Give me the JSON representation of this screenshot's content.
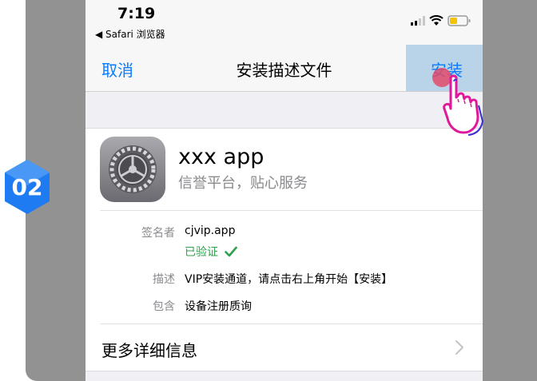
{
  "step": {
    "number": "02",
    "color": "#1e7bf2"
  },
  "status_bar": {
    "time": "7:19",
    "back_app": "◀ Safari 浏览器",
    "icons": [
      "signal-icon",
      "wifi-icon",
      "battery-icon"
    ]
  },
  "nav": {
    "cancel_label": "取消",
    "title": "安装描述文件",
    "install_label": "安装"
  },
  "profile": {
    "name": "xxx app",
    "subtitle": "信誉平台，贴心服务",
    "icon": "settings-gear-icon"
  },
  "details": {
    "signer_label": "签名者",
    "signer_value": "cjvip.app",
    "verified_label": "已验证",
    "description_label": "描述",
    "description_value": "VIP安装通道，请点击右上角开始【安装】",
    "contains_label": "包含",
    "contains_value": "设备注册质询"
  },
  "more": {
    "label": "更多详细信息"
  },
  "colors": {
    "accent": "#0a7aff",
    "verified": "#2ca14a",
    "backdrop": "#929292",
    "highlight": "#b9d3e8",
    "pointer": "#e0189a"
  }
}
